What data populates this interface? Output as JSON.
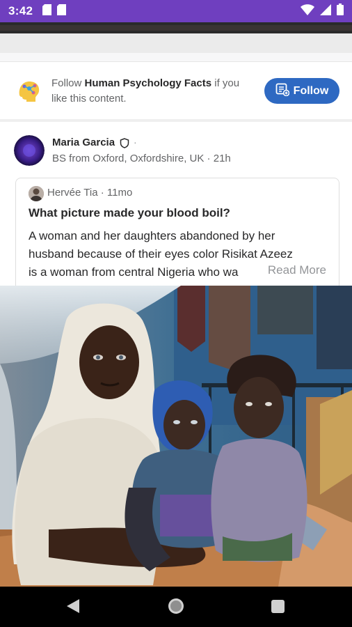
{
  "status_bar": {
    "time": "3:42"
  },
  "follow_card": {
    "prefix": "Follow",
    "space_name": "Human Psychology Facts",
    "suffix": "if you like this content.",
    "button_label": "Follow"
  },
  "post": {
    "author_name": "Maria Garcia",
    "separator": "·",
    "credential": "BS from Oxford, Oxfordshire, UK · 21h"
  },
  "shared_answer": {
    "author": "Hervée Tia",
    "age": "· 11mo",
    "question": "What picture made your blood boil?",
    "line1": "A woman and her daughters abandoned by her",
    "line2": "husband because of their eyes color Risikat Azeez",
    "line3_start": "is a woman from central Nigeria who wa",
    "read_more": "Read More"
  },
  "colors": {
    "status_bar": "#6f3fbf",
    "follow_button": "#2e69c2",
    "nav_bar": "#000000"
  },
  "icons": {
    "status_left": [
      "sd-card-icon",
      "sd-card-icon"
    ],
    "status_right": [
      "wifi-icon",
      "signal-icon",
      "battery-icon"
    ],
    "follow_button": "space-icon",
    "nav": [
      "back-icon",
      "home-icon",
      "recents-icon"
    ]
  }
}
